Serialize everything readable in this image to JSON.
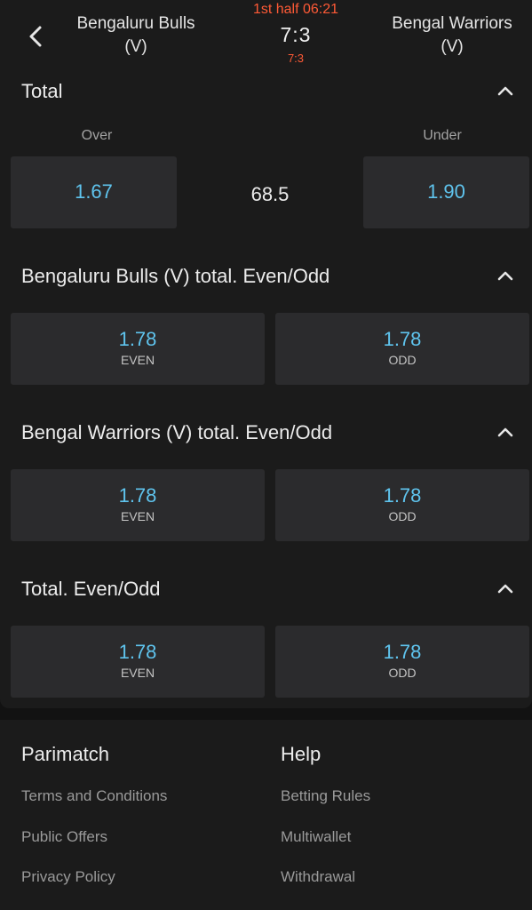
{
  "header": {
    "home_team": "Bengaluru Bulls (V)",
    "away_team": "Bengal Warriors (V)",
    "clock": "1st half 06:21",
    "score": "7:3",
    "subscore": "7:3"
  },
  "markets": {
    "total": {
      "title": "Total",
      "over_label": "Over",
      "under_label": "Under",
      "over_odds": "1.67",
      "line": "68.5",
      "under_odds": "1.90"
    },
    "bulls_even_odd": {
      "title": "Bengaluru Bulls (V) total. Even/Odd",
      "even_odds": "1.78",
      "even_label": "EVEN",
      "odd_odds": "1.78",
      "odd_label": "ODD"
    },
    "warriors_even_odd": {
      "title": "Bengal Warriors (V) total. Even/Odd",
      "even_odds": "1.78",
      "even_label": "EVEN",
      "odd_odds": "1.78",
      "odd_label": "ODD"
    },
    "total_even_odd": {
      "title": "Total. Even/Odd",
      "even_odds": "1.78",
      "even_label": "EVEN",
      "odd_odds": "1.78",
      "odd_label": "ODD"
    }
  },
  "footer": {
    "col1_title": "Parimatch",
    "col1_links": [
      "Terms and Conditions",
      "Public Offers",
      "Privacy Policy"
    ],
    "col2_title": "Help",
    "col2_links": [
      "Betting Rules",
      "Multiwallet",
      "Withdrawal"
    ]
  },
  "icons": {
    "back": "chevron-left-icon",
    "collapse": "chevron-up-icon"
  },
  "colors": {
    "odds": "#5fc4ee",
    "live_clock": "#ff5a36",
    "background": "#121212",
    "panel": "#1b1b1b",
    "button": "#2b2b2d"
  }
}
